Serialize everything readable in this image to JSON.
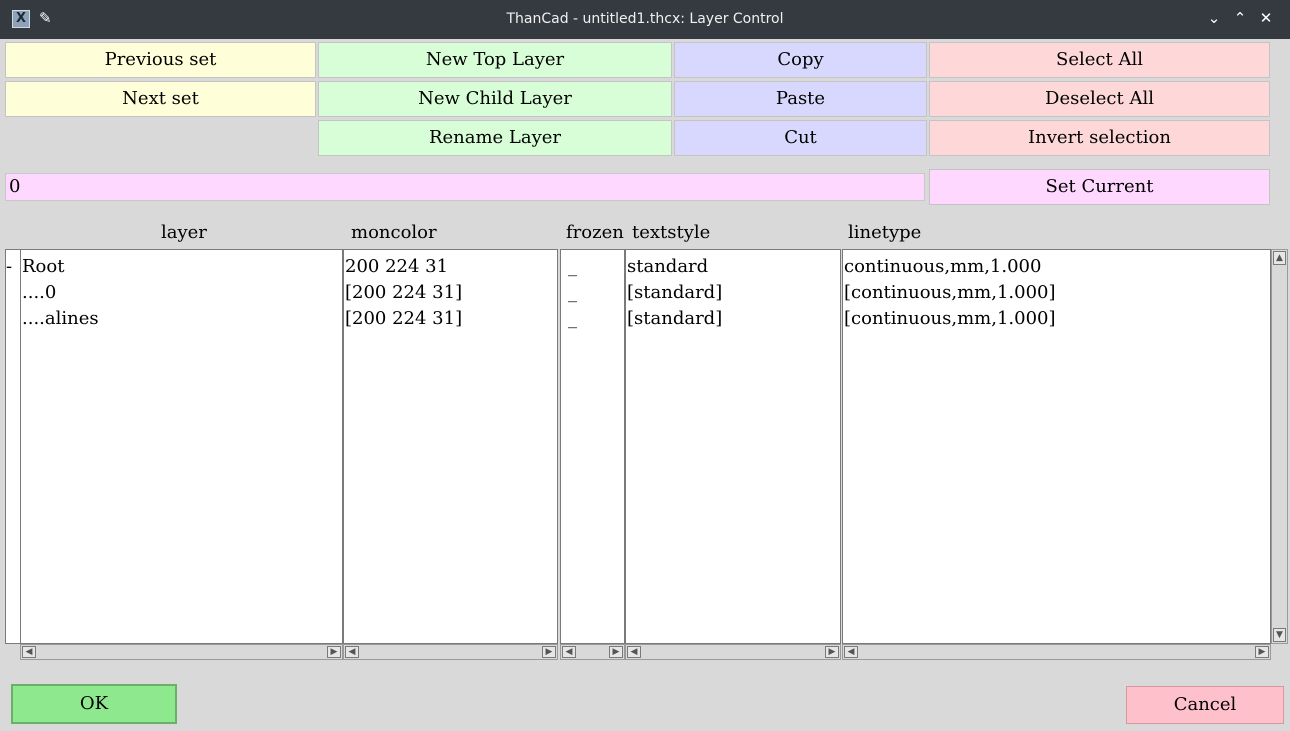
{
  "window": {
    "title": "ThanCad - untitled1.thcx: Layer Control",
    "icons": [
      "app-x-icon",
      "pin-icon"
    ],
    "controls": {
      "minimize": "⌄",
      "maximize": "⌃",
      "close": "✕"
    }
  },
  "toolbar": {
    "previous_set": "Previous set",
    "next_set": "Next set",
    "new_top_layer": "New Top Layer",
    "new_child_layer": "New Child Layer",
    "rename_layer": "Rename Layer",
    "copy": "Copy",
    "paste": "Paste",
    "cut": "Cut",
    "select_all": "Select All",
    "deselect_all": "Deselect All",
    "invert_selection": "Invert selection"
  },
  "current": {
    "value": "0",
    "set_current_label": "Set Current"
  },
  "columns": {
    "layer": "layer",
    "moncolor": "moncolor",
    "frozen": "frozen",
    "textstyle": "textstyle",
    "linetype": "linetype"
  },
  "tree_marker": "-",
  "rows": [
    {
      "layer": "Root",
      "moncolor": "200 224 31",
      "frozen": "_",
      "textstyle": "standard",
      "linetype": "continuous,mm,1.000"
    },
    {
      "layer": "....0",
      "moncolor": "[200 224 31]",
      "frozen": "_",
      "textstyle": "[standard]",
      "linetype": "[continuous,mm,1.000]"
    },
    {
      "layer": "....alines",
      "moncolor": "[200 224 31]",
      "frozen": "_",
      "textstyle": "[standard]",
      "linetype": "[continuous,mm,1.000]"
    }
  ],
  "footer": {
    "ok": "OK",
    "cancel": "Cancel"
  },
  "colors": {
    "titlebar": "#343a40",
    "yellow_button": "#fefed8",
    "green_button": "#d8fed8",
    "blue_button": "#d8d8fe",
    "red_button": "#fed8d8",
    "current_field": "#fed8fe",
    "ok_button": "#8ee98e",
    "cancel_button": "#fec0cb"
  }
}
